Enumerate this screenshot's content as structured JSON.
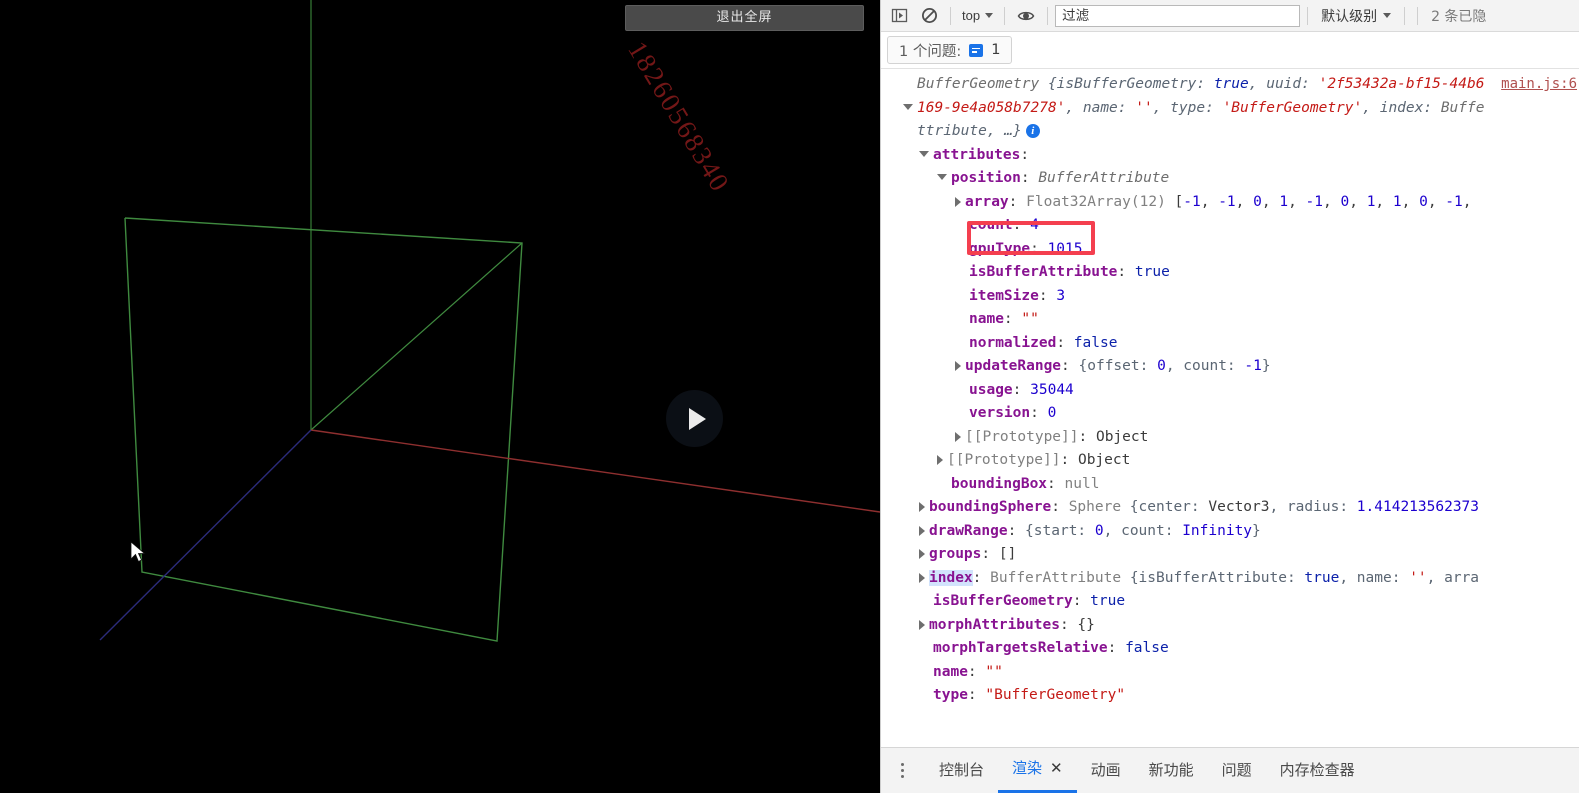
{
  "viewport": {
    "exit_fullscreen_label": "退出全屏",
    "watermark": "18260568340",
    "play_button_name": "play",
    "axes": {
      "x_axis_color": "#8b2b2b",
      "y_axis_color": "#2e6b2e",
      "z_axis_color": "#2b2b8b"
    },
    "wireframe_color": "#3f7a3f"
  },
  "devtools": {
    "toolbar": {
      "sidebar_icon": "sidebar-toggle-icon",
      "clear_icon": "clear-console-icon",
      "context_selector": "top",
      "eye_icon": "live-expression-icon",
      "filter_placeholder": "过滤",
      "filter_value": "",
      "level_selector": "默认级别",
      "hidden_messages": "2 条已隐"
    },
    "issues": {
      "label": "1 个问题:",
      "count": "1"
    },
    "source_link": "main.js:6",
    "log": [
      {
        "indent": 0,
        "arrow": "none",
        "parts": [
          {
            "t": "BufferGeometry ",
            "c": "cls"
          },
          {
            "t": "{isBufferGeometry: ",
            "c": "italic prop"
          },
          {
            "t": "true",
            "c": "italic bool"
          },
          {
            "t": ", uuid: ",
            "c": "italic prop"
          },
          {
            "t": "'2f53432a-bf15-44b6",
            "c": "italic str"
          }
        ]
      },
      {
        "indent": 0,
        "arrow": "down",
        "parts": [
          {
            "t": "169-9e4a058b7278'",
            "c": "italic str"
          },
          {
            "t": ", name: ",
            "c": "italic prop"
          },
          {
            "t": "''",
            "c": "italic str"
          },
          {
            "t": ", type: ",
            "c": "italic prop"
          },
          {
            "t": "'BufferGeometry'",
            "c": "italic str"
          },
          {
            "t": ", index: ",
            "c": "italic prop"
          },
          {
            "t": "Buffe",
            "c": "italic cls"
          }
        ]
      },
      {
        "indent": 0,
        "arrow": "none",
        "badge": true,
        "parts": [
          {
            "t": "ttribute, …}",
            "c": "italic prop"
          }
        ]
      },
      {
        "indent": 1,
        "arrow": "down",
        "parts": [
          {
            "t": "attributes",
            "c": "k"
          },
          {
            "t": ":",
            "c": "plain"
          }
        ]
      },
      {
        "indent": 2,
        "arrow": "down",
        "parts": [
          {
            "t": "position",
            "c": "k"
          },
          {
            "t": ": ",
            "c": "plain"
          },
          {
            "t": "BufferAttribute",
            "c": "cls"
          }
        ]
      },
      {
        "indent": 3,
        "arrow": "right",
        "parts": [
          {
            "t": "array",
            "c": "k"
          },
          {
            "t": ": ",
            "c": "plain"
          },
          {
            "t": "Float32Array(12) ",
            "c": "proto"
          },
          {
            "t": "[",
            "c": "plain"
          },
          {
            "t": "-1",
            "c": "num"
          },
          {
            "t": ", ",
            "c": "plain"
          },
          {
            "t": "-1",
            "c": "num"
          },
          {
            "t": ", ",
            "c": "plain"
          },
          {
            "t": "0",
            "c": "num"
          },
          {
            "t": ", ",
            "c": "plain"
          },
          {
            "t": "1",
            "c": "num"
          },
          {
            "t": ", ",
            "c": "plain"
          },
          {
            "t": "-1",
            "c": "num"
          },
          {
            "t": ", ",
            "c": "plain"
          },
          {
            "t": "0",
            "c": "num"
          },
          {
            "t": ", ",
            "c": "plain"
          },
          {
            "t": "1",
            "c": "num"
          },
          {
            "t": ", ",
            "c": "plain"
          },
          {
            "t": "1",
            "c": "num"
          },
          {
            "t": ", ",
            "c": "plain"
          },
          {
            "t": "0",
            "c": "num"
          },
          {
            "t": ", ",
            "c": "plain"
          },
          {
            "t": "-1",
            "c": "num"
          },
          {
            "t": ",",
            "c": "plain"
          }
        ]
      },
      {
        "indent": 3,
        "arrow": "none",
        "parts": [
          {
            "t": "count",
            "c": "k"
          },
          {
            "t": ": ",
            "c": "plain"
          },
          {
            "t": "4",
            "c": "num"
          }
        ]
      },
      {
        "indent": 3,
        "arrow": "none",
        "parts": [
          {
            "t": "gpuType",
            "c": "k"
          },
          {
            "t": ": ",
            "c": "plain"
          },
          {
            "t": "1015",
            "c": "num"
          }
        ]
      },
      {
        "indent": 3,
        "arrow": "none",
        "parts": [
          {
            "t": "isBufferAttribute",
            "c": "k"
          },
          {
            "t": ": ",
            "c": "plain"
          },
          {
            "t": "true",
            "c": "bool"
          }
        ]
      },
      {
        "indent": 3,
        "arrow": "none",
        "parts": [
          {
            "t": "itemSize",
            "c": "k"
          },
          {
            "t": ": ",
            "c": "plain"
          },
          {
            "t": "3",
            "c": "num"
          }
        ]
      },
      {
        "indent": 3,
        "arrow": "none",
        "parts": [
          {
            "t": "name",
            "c": "k"
          },
          {
            "t": ": ",
            "c": "plain"
          },
          {
            "t": "\"\"",
            "c": "str"
          }
        ]
      },
      {
        "indent": 3,
        "arrow": "none",
        "parts": [
          {
            "t": "normalized",
            "c": "k"
          },
          {
            "t": ": ",
            "c": "plain"
          },
          {
            "t": "false",
            "c": "bool"
          }
        ]
      },
      {
        "indent": 3,
        "arrow": "right",
        "parts": [
          {
            "t": "updateRange",
            "c": "k"
          },
          {
            "t": ": ",
            "c": "plain"
          },
          {
            "t": "{offset: ",
            "c": "prop"
          },
          {
            "t": "0",
            "c": "num"
          },
          {
            "t": ", count: ",
            "c": "prop"
          },
          {
            "t": "-1",
            "c": "num"
          },
          {
            "t": "}",
            "c": "prop"
          }
        ]
      },
      {
        "indent": 3,
        "arrow": "none",
        "parts": [
          {
            "t": "usage",
            "c": "k"
          },
          {
            "t": ": ",
            "c": "plain"
          },
          {
            "t": "35044",
            "c": "num"
          }
        ]
      },
      {
        "indent": 3,
        "arrow": "none",
        "parts": [
          {
            "t": "version",
            "c": "k"
          },
          {
            "t": ": ",
            "c": "plain"
          },
          {
            "t": "0",
            "c": "num"
          }
        ]
      },
      {
        "indent": 3,
        "arrow": "right",
        "parts": [
          {
            "t": "[[Prototype]]",
            "c": "proto"
          },
          {
            "t": ": ",
            "c": "plain"
          },
          {
            "t": "Object",
            "c": "plain"
          }
        ]
      },
      {
        "indent": 2,
        "arrow": "right",
        "parts": [
          {
            "t": "[[Prototype]]",
            "c": "proto"
          },
          {
            "t": ": ",
            "c": "plain"
          },
          {
            "t": "Object",
            "c": "plain"
          }
        ]
      },
      {
        "indent": 2,
        "arrow": "none",
        "parts": [
          {
            "t": "boundingBox",
            "c": "k"
          },
          {
            "t": ": ",
            "c": "plain"
          },
          {
            "t": "null",
            "c": "nullv"
          }
        ]
      },
      {
        "indent": 1,
        "arrow": "right",
        "parts": [
          {
            "t": "boundingSphere",
            "c": "k"
          },
          {
            "t": ": ",
            "c": "plain"
          },
          {
            "t": "Sphere ",
            "c": "proto"
          },
          {
            "t": "{center: ",
            "c": "prop"
          },
          {
            "t": "Vector3",
            "c": "plain"
          },
          {
            "t": ", radius: ",
            "c": "prop"
          },
          {
            "t": "1.414213562373",
            "c": "num"
          }
        ]
      },
      {
        "indent": 1,
        "arrow": "right",
        "parts": [
          {
            "t": "drawRange",
            "c": "k"
          },
          {
            "t": ": ",
            "c": "plain"
          },
          {
            "t": "{start: ",
            "c": "prop"
          },
          {
            "t": "0",
            "c": "num"
          },
          {
            "t": ", count: ",
            "c": "prop"
          },
          {
            "t": "Infinity",
            "c": "num"
          },
          {
            "t": "}",
            "c": "prop"
          }
        ]
      },
      {
        "indent": 1,
        "arrow": "right",
        "parts": [
          {
            "t": "groups",
            "c": "k"
          },
          {
            "t": ": ",
            "c": "plain"
          },
          {
            "t": "[]",
            "c": "plain"
          }
        ]
      },
      {
        "indent": 1,
        "arrow": "right",
        "parts": [
          {
            "t": "index",
            "c": "k-hl"
          },
          {
            "t": ": ",
            "c": "plain"
          },
          {
            "t": "BufferAttribute ",
            "c": "proto"
          },
          {
            "t": "{isBufferAttribute: ",
            "c": "prop"
          },
          {
            "t": "true",
            "c": "bool"
          },
          {
            "t": ", name: ",
            "c": "prop"
          },
          {
            "t": "''",
            "c": "str"
          },
          {
            "t": ", arra",
            "c": "prop"
          }
        ]
      },
      {
        "indent": 1,
        "arrow": "none",
        "parts": [
          {
            "t": "isBufferGeometry",
            "c": "k"
          },
          {
            "t": ": ",
            "c": "plain"
          },
          {
            "t": "true",
            "c": "bool"
          }
        ]
      },
      {
        "indent": 1,
        "arrow": "right",
        "parts": [
          {
            "t": "morphAttributes",
            "c": "k"
          },
          {
            "t": ": ",
            "c": "plain"
          },
          {
            "t": "{}",
            "c": "plain"
          }
        ]
      },
      {
        "indent": 1,
        "arrow": "none",
        "parts": [
          {
            "t": "morphTargetsRelative",
            "c": "k"
          },
          {
            "t": ": ",
            "c": "plain"
          },
          {
            "t": "false",
            "c": "bool"
          }
        ]
      },
      {
        "indent": 1,
        "arrow": "none",
        "parts": [
          {
            "t": "name",
            "c": "k"
          },
          {
            "t": ": ",
            "c": "plain"
          },
          {
            "t": "\"\"",
            "c": "str"
          }
        ]
      },
      {
        "indent": 1,
        "arrow": "none",
        "parts": [
          {
            "t": "type",
            "c": "k"
          },
          {
            "t": ": ",
            "c": "plain"
          },
          {
            "t": "\"BufferGeometry\"",
            "c": "str"
          }
        ]
      }
    ],
    "panel_tabs": [
      {
        "label": "控制台",
        "active": false,
        "closable": false
      },
      {
        "label": "渲染",
        "active": true,
        "closable": true,
        "close_label": "✕"
      },
      {
        "label": "动画",
        "active": false,
        "closable": false
      },
      {
        "label": "新功能",
        "active": false,
        "closable": false
      },
      {
        "label": "问题",
        "active": false,
        "closable": false
      },
      {
        "label": "内存检查器",
        "active": false,
        "closable": false
      }
    ]
  },
  "annotation": {
    "highlight_target": "count: 4",
    "color": "#f43f4f"
  }
}
